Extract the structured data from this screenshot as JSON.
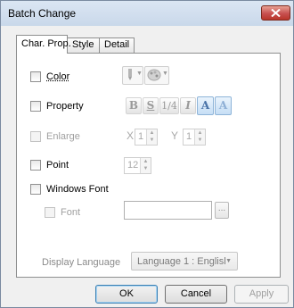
{
  "window": {
    "title": "Batch Change"
  },
  "tabs": [
    {
      "label": "Char. Prop."
    },
    {
      "label": "Style"
    },
    {
      "label": "Detail"
    }
  ],
  "options": {
    "color": {
      "label": "Color"
    },
    "property": {
      "label": "Property",
      "buttons": {
        "bold": "B",
        "shadow": "S",
        "quarter": "1/4",
        "italic": "I",
        "a_light": "A",
        "a_outline": "A"
      }
    },
    "enlarge": {
      "label": "Enlarge",
      "x_label": "X",
      "x_value": "1",
      "y_label": "Y",
      "y_value": "1"
    },
    "point": {
      "label": "Point",
      "value": "12"
    },
    "windows_font": {
      "label": "Windows Font"
    },
    "font": {
      "label": "Font",
      "value": "",
      "browse_label": "..."
    },
    "display_language": {
      "label": "Display Language",
      "selected": "Language 1 : Englisl"
    }
  },
  "buttons": {
    "ok": "OK",
    "cancel": "Cancel",
    "apply": "Apply"
  },
  "colors": {
    "accent": "#4a73a8",
    "close": "#c75050"
  }
}
